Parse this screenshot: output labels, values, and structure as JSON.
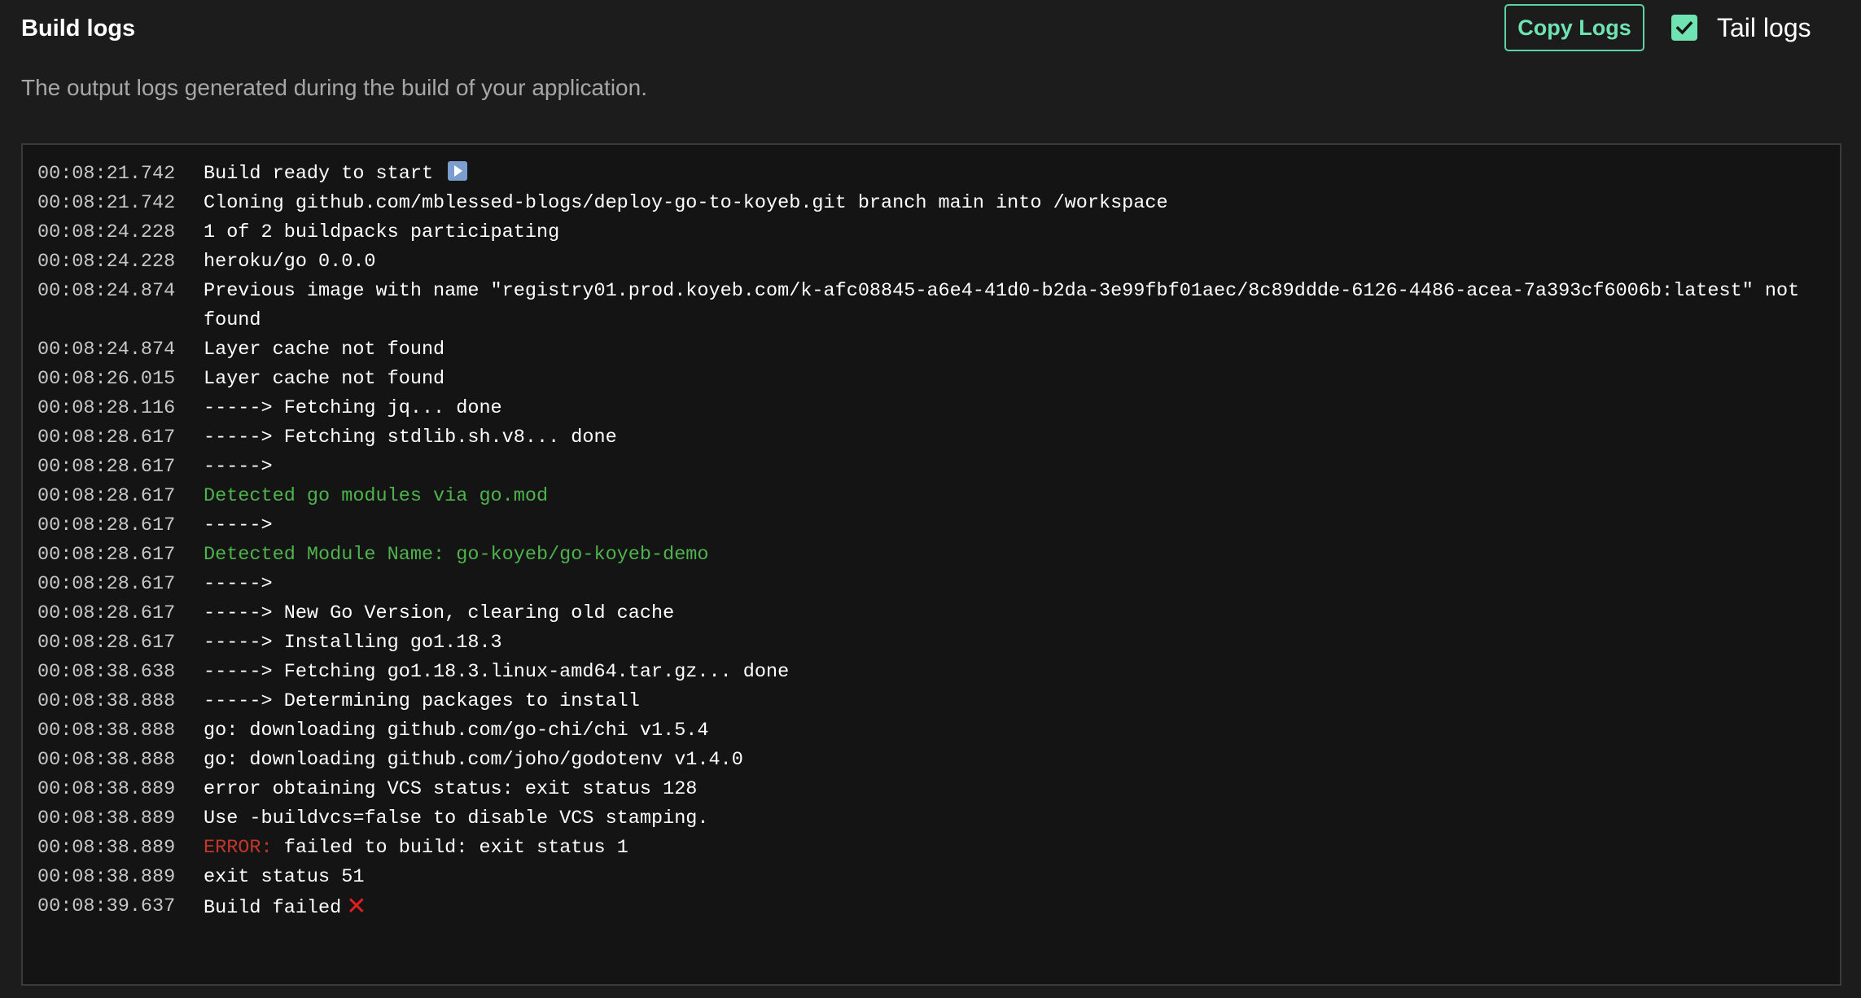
{
  "header": {
    "title": "Build logs",
    "subtitle": "The output logs generated during the build of your application.",
    "copy_button": "Copy Logs",
    "tail_label": "Tail logs",
    "tail_checked": true
  },
  "colors": {
    "accent": "#6fe3b1",
    "green_text": "#4fb34d",
    "error_text": "#c2362c"
  },
  "logs": [
    {
      "ts": "00:08:21.742",
      "msg": "Build ready to start",
      "icon": "play-icon"
    },
    {
      "ts": "00:08:21.742",
      "msg": "Cloning github.com/mblessed-blogs/deploy-go-to-koyeb.git branch main into /workspace"
    },
    {
      "ts": "00:08:24.228",
      "msg": "1 of 2 buildpacks participating"
    },
    {
      "ts": "00:08:24.228",
      "msg": "heroku/go 0.0.0"
    },
    {
      "ts": "00:08:24.874",
      "msg": "Previous image with name \"registry01.prod.koyeb.com/k-afc08845-a6e4-41d0-b2da-3e99fbf01aec/8c89ddde-6126-4486-acea-7a393cf6006b:latest\" not found"
    },
    {
      "ts": "00:08:24.874",
      "msg": "Layer cache not found"
    },
    {
      "ts": "00:08:26.015",
      "msg": "Layer cache not found"
    },
    {
      "ts": "00:08:28.116",
      "msg": "-----> Fetching jq... done"
    },
    {
      "ts": "00:08:28.617",
      "msg": "-----> Fetching stdlib.sh.v8... done"
    },
    {
      "ts": "00:08:28.617",
      "msg": "----->"
    },
    {
      "ts": "00:08:28.617",
      "msg": "Detected go modules via go.mod",
      "style": "green"
    },
    {
      "ts": "00:08:28.617",
      "msg": "----->"
    },
    {
      "ts": "00:08:28.617",
      "msg": "Detected Module Name: go-koyeb/go-koyeb-demo",
      "style": "green"
    },
    {
      "ts": "00:08:28.617",
      "msg": "----->"
    },
    {
      "ts": "00:08:28.617",
      "msg": "-----> New Go Version, clearing old cache"
    },
    {
      "ts": "00:08:28.617",
      "msg": "-----> Installing go1.18.3"
    },
    {
      "ts": "00:08:38.638",
      "msg": "-----> Fetching go1.18.3.linux-amd64.tar.gz... done"
    },
    {
      "ts": "00:08:38.888",
      "msg": "-----> Determining packages to install"
    },
    {
      "ts": "00:08:38.888",
      "msg": "go: downloading github.com/go-chi/chi v1.5.4"
    },
    {
      "ts": "00:08:38.888",
      "msg": "go: downloading github.com/joho/godotenv v1.4.0"
    },
    {
      "ts": "00:08:38.889",
      "msg": "error obtaining VCS status: exit status 128"
    },
    {
      "ts": "00:08:38.889",
      "msg": "Use -buildvcs=false to disable VCS stamping."
    },
    {
      "ts": "00:08:38.889",
      "prefix": "ERROR:",
      "msg": "failed to build: exit status 1"
    },
    {
      "ts": "00:08:38.889",
      "msg": "exit status 51"
    },
    {
      "ts": "00:08:39.637",
      "msg": "Build failed",
      "icon": "cross-icon"
    }
  ]
}
